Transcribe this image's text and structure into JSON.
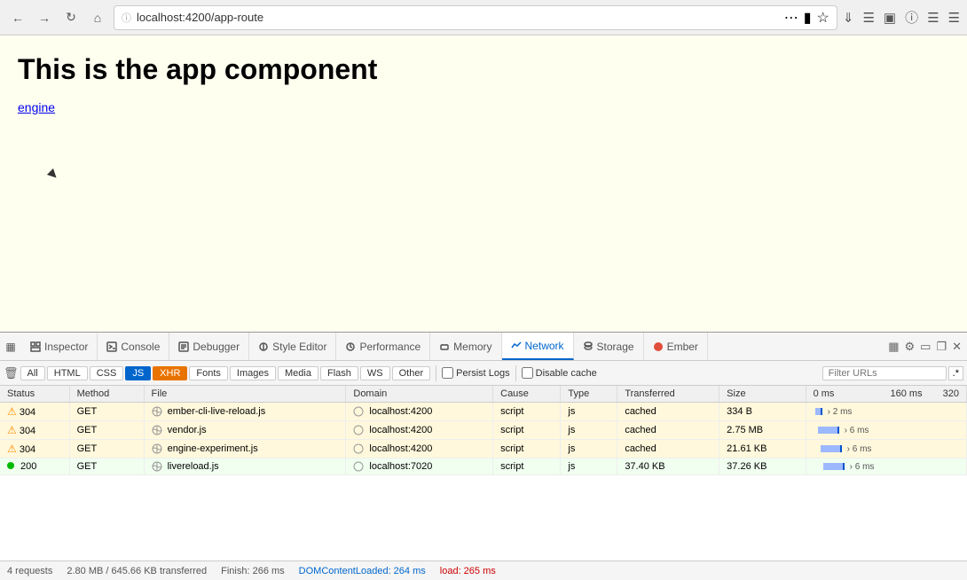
{
  "browser": {
    "url": "localhost:4200/app-route",
    "url_placeholder": "localhost:4200/app-route"
  },
  "page": {
    "title": "This is the app component",
    "link_text": "engine"
  },
  "devtools": {
    "tabs": [
      {
        "id": "inspector",
        "label": "Inspector",
        "icon": "inspector",
        "active": false
      },
      {
        "id": "console",
        "label": "Console",
        "icon": "console",
        "active": false
      },
      {
        "id": "debugger",
        "label": "Debugger",
        "icon": "debugger",
        "active": false
      },
      {
        "id": "style-editor",
        "label": "Style Editor",
        "icon": "style",
        "active": false
      },
      {
        "id": "performance",
        "label": "Performance",
        "icon": "performance",
        "active": false
      },
      {
        "id": "memory",
        "label": "Memory",
        "icon": "memory",
        "active": false
      },
      {
        "id": "network",
        "label": "Network",
        "icon": "network",
        "active": true
      },
      {
        "id": "storage",
        "label": "Storage",
        "icon": "storage",
        "active": false
      },
      {
        "id": "ember",
        "label": "Ember",
        "icon": "ember",
        "active": false
      }
    ]
  },
  "network_filters": {
    "all_label": "All",
    "html_label": "HTML",
    "css_label": "CSS",
    "js_label": "JS",
    "xhr_label": "XHR",
    "fonts_label": "Fonts",
    "images_label": "Images",
    "media_label": "Media",
    "flash_label": "Flash",
    "ws_label": "WS",
    "other_label": "Other",
    "persist_logs_label": "Persist Logs",
    "disable_cache_label": "Disable cache",
    "filter_placeholder": "Filter URLs"
  },
  "table": {
    "headers": [
      "Status",
      "Method",
      "File",
      "Domain",
      "Cause",
      "Type",
      "Transferred",
      "Size",
      "0 ms",
      "160 ms",
      "320"
    ],
    "rows": [
      {
        "status": "304",
        "method": "GET",
        "file": "ember-cli-live-reload.js",
        "domain": "localhost:4200",
        "cause": "script",
        "type": "js",
        "transferred": "cached",
        "size": "334 B",
        "timeline": "2 ms",
        "warning": true,
        "success": false
      },
      {
        "status": "304",
        "method": "GET",
        "file": "vendor.js",
        "domain": "localhost:4200",
        "cause": "script",
        "type": "js",
        "transferred": "cached",
        "size": "2.75 MB",
        "timeline": "6 ms",
        "warning": true,
        "success": false
      },
      {
        "status": "304",
        "method": "GET",
        "file": "engine-experiment.js",
        "domain": "localhost:4200",
        "cause": "script",
        "type": "js",
        "transferred": "cached",
        "size": "21.61 KB",
        "timeline": "6 ms",
        "warning": true,
        "success": false
      },
      {
        "status": "200",
        "method": "GET",
        "file": "livereload.js",
        "domain": "localhost:7020",
        "cause": "script",
        "type": "js",
        "transferred": "37.40 KB",
        "size": "37.26 KB",
        "timeline": "6 ms",
        "warning": false,
        "success": true
      }
    ]
  },
  "status_bar": {
    "requests": "4 requests",
    "transferred": "2.80 MB / 645.66 KB transferred",
    "finish": "Finish: 266 ms",
    "dom_content": "DOMContentLoaded: 264 ms",
    "load": "load: 265 ms"
  }
}
